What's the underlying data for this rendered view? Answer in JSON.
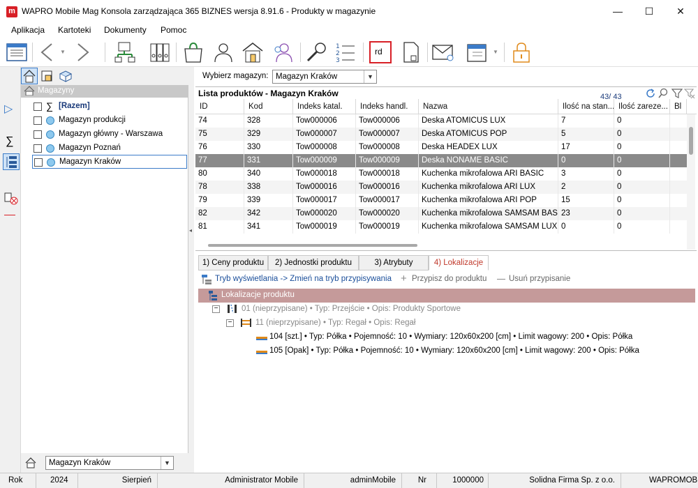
{
  "window": {
    "logo_letter": "m",
    "title": "WAPRO Mobile Mag Konsola zarządzająca 365 BIZNES wersja 8.91.6 - Produkty w magazynie",
    "minimize": "—",
    "maximize": "☐",
    "close": "✕"
  },
  "menu": [
    "Aplikacja",
    "Kartoteki",
    "Dokumenty",
    "Pomoc"
  ],
  "toolbar": {
    "icons": [
      "main-menu-icon",
      "back-icon",
      "forward-icon",
      "network-icon",
      "binders-icon",
      "shopping-bag-icon",
      "user-icon",
      "warehouse-icon",
      "users-icon",
      "wrench-icon",
      "numbered-list-icon",
      "document-rd-icon",
      "document-icon",
      "mail-user-icon",
      "calendar-icon",
      "lock-icon"
    ],
    "rd_label": "rd"
  },
  "tree": {
    "header": "Magazyny",
    "items": [
      {
        "label": "[Razem]",
        "bold": true
      },
      {
        "label": "Magazyn produkcji"
      },
      {
        "label": "Magazyn główny - Warszawa"
      },
      {
        "label": "Magazyn Poznań"
      },
      {
        "label": "Magazyn Kraków"
      }
    ],
    "bottom_select": "Magazyn Kraków"
  },
  "warehouse_select": {
    "label": "Wybierz magazyn:",
    "value": "Magazyn Kraków"
  },
  "list": {
    "title": "Lista produktów - Magazyn Kraków",
    "count": "43",
    "total": "43",
    "columns": [
      "ID",
      "Kod",
      "Indeks katal.",
      "Indeks handl.",
      "Nazwa",
      "Ilość na stan...",
      "Ilość zareze...",
      "Bl"
    ],
    "rows": [
      [
        "74",
        "328",
        "Tow000006",
        "Tow000006",
        "Deska ATOMICUS LUX",
        "7",
        "0"
      ],
      [
        "75",
        "329",
        "Tow000007",
        "Tow000007",
        "Deska ATOMICUS POP",
        "5",
        "0"
      ],
      [
        "76",
        "330",
        "Tow000008",
        "Tow000008",
        "Deska HEADEX LUX",
        "17",
        "0"
      ],
      [
        "77",
        "331",
        "Tow000009",
        "Tow000009",
        "Deska NONAME BASIC",
        "0",
        "0"
      ],
      [
        "80",
        "340",
        "Tow000018",
        "Tow000018",
        "Kuchenka mikrofalowa ARI BASIC",
        "3",
        "0"
      ],
      [
        "78",
        "338",
        "Tow000016",
        "Tow000016",
        "Kuchenka mikrofalowa ARI LUX",
        "2",
        "0"
      ],
      [
        "79",
        "339",
        "Tow000017",
        "Tow000017",
        "Kuchenka mikrofalowa ARI POP",
        "15",
        "0"
      ],
      [
        "82",
        "342",
        "Tow000020",
        "Tow000020",
        "Kuchenka mikrofalowa SAMSAM BASI",
        "23",
        "0"
      ],
      [
        "81",
        "341",
        "Tow000019",
        "Tow000019",
        "Kuchenka mikrofalowa SAMSAM LUX",
        "0",
        "0"
      ]
    ],
    "selected_index": 3
  },
  "detail": {
    "tabs": [
      "1) Ceny produktu",
      "2) Jednostki produktu",
      "3) Atrybuty",
      "4) Lokalizacje"
    ],
    "active_tab": 3,
    "mode_link": "Tryb wyświetlania -> Zmień na tryb przypisywania",
    "assign": "Przypisz do produktu",
    "unassign": "Usuń przypisanie",
    "section_title": "Lokalizacje produktu",
    "tree": [
      {
        "expander": "−",
        "text": "01 (nieprzypisane) • Typ: Przejście • Opis: Produkty Sportowe",
        "muted": true
      },
      {
        "expander": "−",
        "text": "11 (nieprzypisane) • Typ: Regał • Opis: Regał",
        "muted": true
      },
      {
        "text": "104 [szt.] • Typ: Półka • Pojemność: 10 • Wymiary: 120x60x200 [cm] • Limit wagowy: 200 • Opis: Półka",
        "muted": false
      },
      {
        "text": "105 [Opak] • Typ: Półka • Pojemność: 10 • Wymiary: 120x60x200 [cm] • Limit wagowy: 200 • Opis: Półka",
        "muted": false
      }
    ]
  },
  "status": {
    "rok_label": "Rok",
    "rok": "2024",
    "month": "Sierpień",
    "user": "Administrator Mobile",
    "login": "adminMobile",
    "nr_label": "Nr",
    "nr": "1000000",
    "company": "Solidna Firma Sp. z o.o.",
    "app": "WAPROMOBI"
  },
  "colors": {
    "accent_red": "#d81f26",
    "selected_row": "#8a8a8a",
    "location_header": "#c59a9a",
    "link_blue": "#1a4e9a"
  }
}
